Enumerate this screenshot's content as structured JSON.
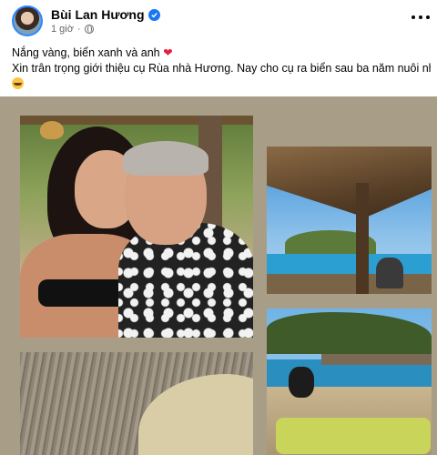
{
  "post": {
    "author": "Bùi Lan Hương",
    "time": "1 giờ",
    "caption_line1": "Nắng vàng, biển xanh và anh",
    "caption_line2": "Xin trân trọng giới thiệu cụ Rùa nhà Hương. Nay cho cụ ra biển sau ba năm nuôi nhốt"
  },
  "icons": {
    "verified": "verified-badge-icon",
    "privacy": "globe-icon",
    "more": "more-options-icon",
    "heart": "red-heart-emoji",
    "laugh": "laughing-emoji"
  },
  "colors": {
    "verified": "#1877f2",
    "meta_text": "#65676b",
    "heart": "#e41e3f",
    "collage_bg": "#a89e88"
  }
}
